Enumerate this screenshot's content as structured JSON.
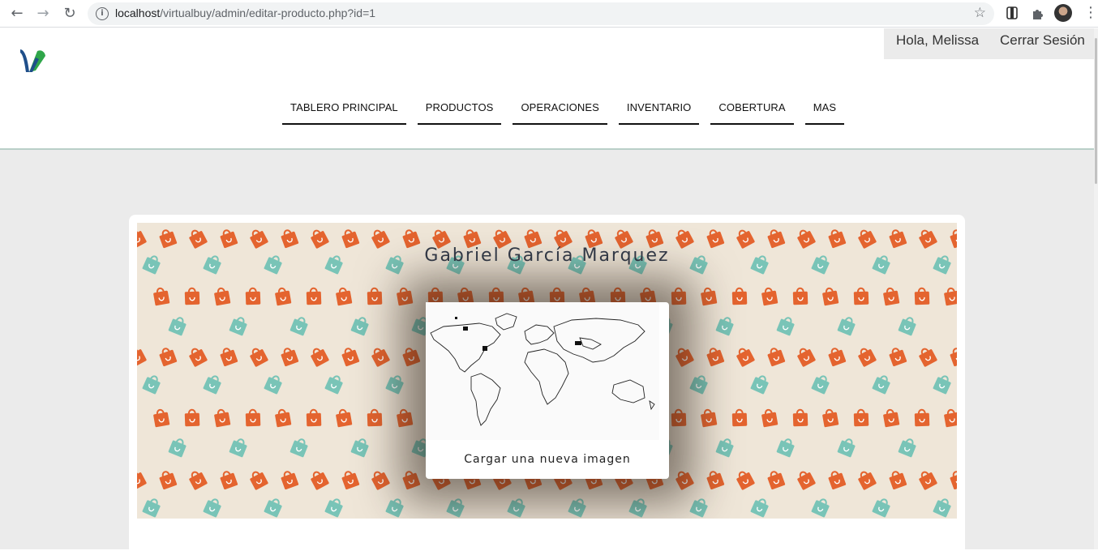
{
  "browser": {
    "url_host": "localhost",
    "url_path": "/virtualbuy/admin/editar-producto.php?id=1"
  },
  "header": {
    "greeting": "Hola, Melissa",
    "logout": "Cerrar Sesión",
    "menu": [
      {
        "label": "TABLERO PRINCIPAL"
      },
      {
        "label": "PRODUCTOS"
      },
      {
        "label": "OPERACIONES"
      },
      {
        "label": "INVENTARIO"
      },
      {
        "label": "COBERTURA"
      },
      {
        "label": "MAS"
      }
    ]
  },
  "product": {
    "title": "Gabriel García Marquez",
    "upload_label": "Cargar una nueva imagen"
  },
  "colors": {
    "banner_bg": "#efe6d8",
    "bag_orange": "#e4642f",
    "bag_teal": "#79c4b7",
    "page_bg": "#ebebeb"
  }
}
